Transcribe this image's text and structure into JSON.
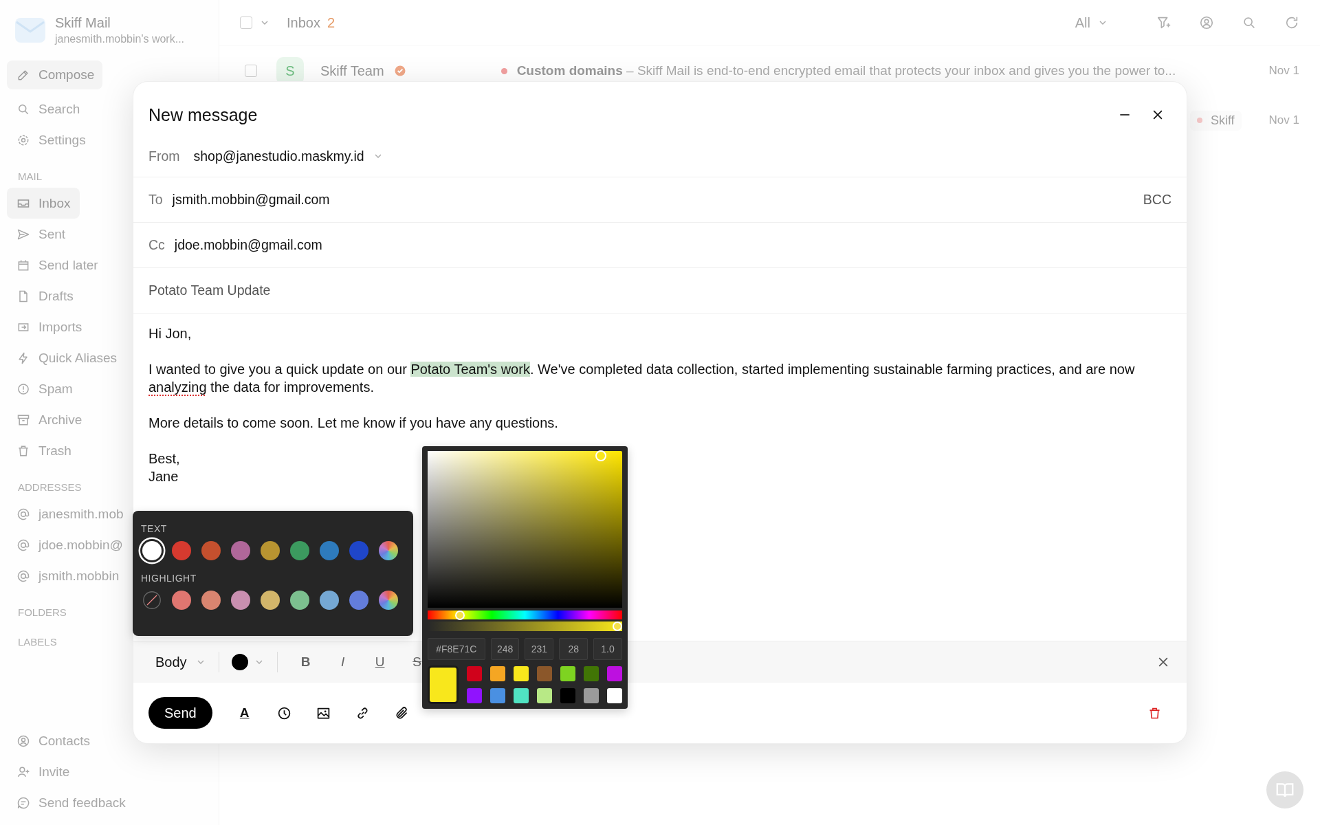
{
  "app": {
    "name": "Skiff Mail",
    "workspace": "janesmith.mobbin's work..."
  },
  "sidebar": {
    "compose": "Compose",
    "top_items": [
      {
        "label": "Search"
      },
      {
        "label": "Settings"
      }
    ],
    "mail_title": "MAIL",
    "mail_items": [
      {
        "label": "Inbox",
        "selected": true
      },
      {
        "label": "Sent",
        "selected": false
      },
      {
        "label": "Send later",
        "selected": false
      },
      {
        "label": "Drafts",
        "selected": false
      },
      {
        "label": "Imports",
        "selected": false
      },
      {
        "label": "Quick Aliases",
        "selected": false
      },
      {
        "label": "Spam",
        "selected": false
      },
      {
        "label": "Archive",
        "selected": false
      },
      {
        "label": "Trash",
        "selected": false
      }
    ],
    "addresses_title": "ADDRESSES",
    "addresses": [
      "janesmith.mob",
      "jdoe.mobbin@",
      "jsmith.mobbin"
    ],
    "folders_title": "FOLDERS",
    "labels_title": "LABELS",
    "bottom_items": [
      {
        "label": "Contacts"
      },
      {
        "label": "Invite"
      },
      {
        "label": "Send feedback"
      }
    ]
  },
  "inbox": {
    "select_all": {
      "checked": false
    },
    "title": "Inbox",
    "count": "2",
    "filter": "All",
    "rows": [
      {
        "checked": false,
        "avatar": "S",
        "sender": "Skiff Team",
        "verified": true,
        "unread": true,
        "subject": "Custom domains",
        "separator": "–",
        "preview": "Skiff Mail is end-to-end encrypted email that protects your inbox and gives you the power to...",
        "date": "Nov 1"
      },
      {
        "tag": "Skiff",
        "date": "Nov 1"
      }
    ]
  },
  "compose": {
    "title": "New message",
    "from_label": "From",
    "from": "shop@janestudio.maskmy.id",
    "to_label": "To",
    "to": "jsmith.mobbin@gmail.com",
    "bcc": "BCC",
    "cc_label": "Cc",
    "cc": "jdoe.mobbin@gmail.com",
    "subject": "Potato Team Update",
    "body": [
      [
        {
          "kind": "plain",
          "text": "Hi Jon,"
        }
      ],
      [
        {
          "kind": "plain",
          "text": "I wanted to give you a quick update on our "
        },
        {
          "kind": "highlight",
          "text": "Potato Team's work"
        },
        {
          "kind": "plain",
          "text": ". We've completed data collection, started implementing sustainable farming practices, and are now "
        },
        {
          "kind": "misspelled",
          "text": "analyzing"
        },
        {
          "kind": "plain",
          "text": " the data for improvements."
        }
      ],
      [
        {
          "kind": "plain",
          "text": "More details to come soon. Let me know if you have any questions."
        }
      ],
      [
        {
          "kind": "plain",
          "text": "Best,"
        },
        {
          "kind": "break"
        },
        {
          "kind": "plain",
          "text": "Jane"
        }
      ]
    ],
    "toolbar": {
      "style": "Body",
      "format_buttons": [
        {
          "text": "B",
          "kind": "bold"
        },
        {
          "text": "I",
          "kind": "italic"
        },
        {
          "text": "U",
          "kind": "underline"
        },
        {
          "text": "S",
          "kind": "strike"
        }
      ]
    },
    "send": "Send",
    "text_color_button": "A"
  },
  "palette": {
    "text_title": "TEXT",
    "text_colors": [
      {
        "kind": "swatch",
        "color": "#ffffff",
        "selected": true
      },
      {
        "kind": "swatch",
        "color": "#d63a2f",
        "selected": false
      },
      {
        "kind": "swatch",
        "color": "#c4502e",
        "selected": false
      },
      {
        "kind": "swatch",
        "color": "#b0679a",
        "selected": false
      },
      {
        "kind": "swatch",
        "color": "#b89431",
        "selected": false
      },
      {
        "kind": "swatch",
        "color": "#3c9a5f",
        "selected": false
      },
      {
        "kind": "swatch",
        "color": "#2e7bbd",
        "selected": false
      },
      {
        "kind": "swatch",
        "color": "#1f46c9",
        "selected": false
      },
      {
        "kind": "custom",
        "selected": false
      }
    ],
    "highlight_title": "HIGHLIGHT",
    "highlight_colors": [
      {
        "kind": "none",
        "selected": false
      },
      {
        "kind": "swatch",
        "color": "#e07670",
        "selected": false
      },
      {
        "kind": "swatch",
        "color": "#d98570",
        "selected": false
      },
      {
        "kind": "swatch",
        "color": "#c98fb0",
        "selected": false
      },
      {
        "kind": "swatch",
        "color": "#d2b56a",
        "selected": false
      },
      {
        "kind": "swatch",
        "color": "#7cc08f",
        "selected": false
      },
      {
        "kind": "swatch",
        "color": "#75a8d4",
        "selected": false
      },
      {
        "kind": "swatch",
        "color": "#637ddb",
        "selected": false
      },
      {
        "kind": "custom",
        "selected": false
      }
    ]
  },
  "picker": {
    "hex": "#F8E71C",
    "r": "248",
    "g": "231",
    "b": "28",
    "a": "1.0",
    "hue": {
      "level": 0.15
    },
    "alpha": {
      "level": 1.0
    },
    "swatches": [
      {
        "color": "#d0021b"
      },
      {
        "color": "#f5a623"
      },
      {
        "color": "#f8e71c"
      },
      {
        "color": "#8b572a"
      },
      {
        "color": "#7ed321"
      },
      {
        "color": "#417505"
      },
      {
        "color": "#bd10e0"
      },
      {
        "color": "#9013fe"
      },
      {
        "color": "#4a90e2"
      },
      {
        "color": "#50e3c2"
      },
      {
        "color": "#b8e986"
      },
      {
        "color": "#000000"
      },
      {
        "color": "#9b9b9b"
      },
      {
        "color": "#ffffff"
      }
    ]
  }
}
